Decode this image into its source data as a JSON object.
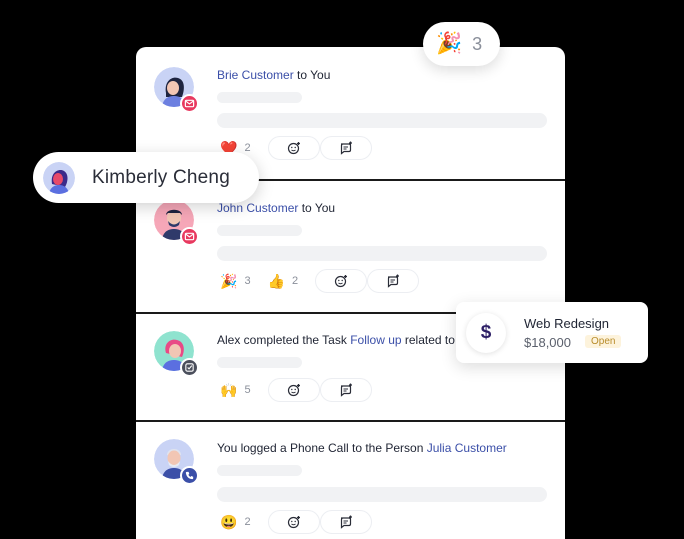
{
  "feed": [
    {
      "actor": "Brie Customer",
      "connector": " to You",
      "badge_icon": "mail-icon",
      "badge_color": "#e8395f",
      "reactions": [
        {
          "emoji": "❤️",
          "count": "2"
        }
      ]
    },
    {
      "actor": "John Customer",
      "connector": " to You",
      "badge_icon": "mail-icon",
      "badge_color": "#e8395f",
      "reactions": [
        {
          "emoji": "🎉",
          "count": "3"
        },
        {
          "emoji": "👍",
          "count": "2"
        }
      ]
    },
    {
      "prefix": "Alex completed the Task ",
      "link": "Follow up",
      "suffix": " related to",
      "badge_icon": "task-check-icon",
      "badge_color": "#4b4f5c",
      "reactions": [
        {
          "emoji": "🙌",
          "count": "5"
        }
      ]
    },
    {
      "prefix": "You logged a Phone Call to the Person ",
      "link": "Julia Customer",
      "badge_icon": "phone-icon",
      "badge_color": "#3b4fa8",
      "reactions": [
        {
          "emoji": "😃",
          "count": "2"
        }
      ]
    }
  ],
  "mention_chip": {
    "name": "Kimberly Cheng"
  },
  "party_reaction": {
    "emoji": "🎉",
    "count": "3"
  },
  "deal_card": {
    "icon": "$",
    "title": "Web Redesign",
    "amount": "$18,000",
    "status": "Open"
  },
  "colors": {
    "link": "#3b4fa8",
    "status_bg": "#fdf3dc",
    "status_text": "#b88c2a"
  }
}
